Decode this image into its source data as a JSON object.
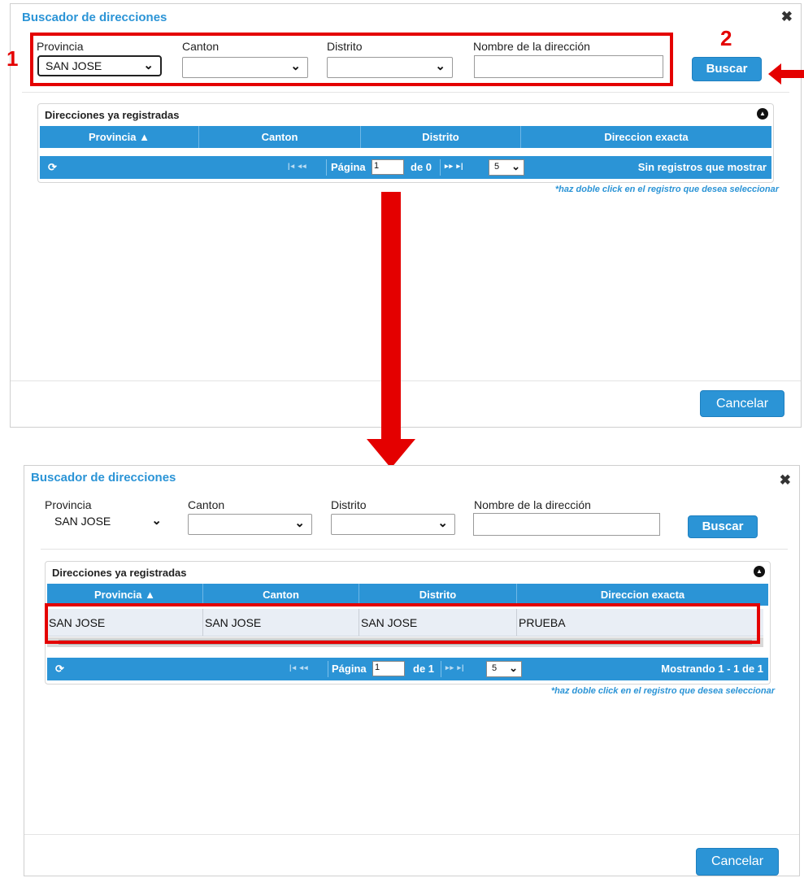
{
  "dialog1": {
    "title": "Buscador de direcciones",
    "close": "✖",
    "labels": {
      "provincia": "Provincia",
      "canton": "Canton",
      "distrito": "Distrito",
      "nombre": "Nombre de la dirección"
    },
    "provincia_value": "SAN JOSE",
    "canton_value": "",
    "distrito_value": "",
    "nombre_value": "",
    "buscar": "Buscar",
    "grid_caption": "Direcciones ya registradas",
    "columns": [
      "Provincia ▲",
      "Canton",
      "Distrito",
      "Direccion exacta"
    ],
    "pager": {
      "pagina": "Página",
      "page_value": "1",
      "de": "de 0",
      "size": "5",
      "info": "Sin registros que mostrar"
    },
    "hint": "*haz doble click en el registro que desea seleccionar",
    "cancelar": "Cancelar"
  },
  "dialog2": {
    "title": "Buscador de direcciones",
    "close": "✖",
    "labels": {
      "provincia": "Provincia",
      "canton": "Canton",
      "distrito": "Distrito",
      "nombre": "Nombre de la dirección"
    },
    "provincia_value": "SAN JOSE",
    "canton_value": "",
    "distrito_value": "",
    "nombre_value": "",
    "buscar": "Buscar",
    "grid_caption": "Direcciones ya registradas",
    "columns": [
      "Provincia ▲",
      "Canton",
      "Distrito",
      "Direccion exacta"
    ],
    "rows": [
      [
        "SAN JOSE",
        "SAN JOSE",
        "SAN JOSE",
        "PRUEBA"
      ]
    ],
    "pager": {
      "pagina": "Página",
      "page_value": "1",
      "de": "de 1",
      "size": "5",
      "info": "Mostrando 1 - 1 de 1"
    },
    "hint": "*haz doble click en el registro que desea seleccionar",
    "cancelar": "Cancelar"
  },
  "annotations": {
    "step1": "1",
    "step2": "2",
    "color": "#e40000"
  },
  "colors": {
    "accent": "#2b94d6",
    "row_bg": "#e9eef5"
  },
  "icons": {
    "close": "close-icon",
    "chevron": "chevron-down-icon",
    "refresh": "refresh-icon",
    "collapse": "collapse-icon"
  }
}
